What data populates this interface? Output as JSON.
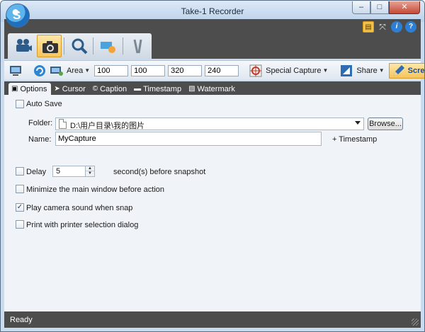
{
  "window": {
    "title": "Take-1 Recorder"
  },
  "window_buttons": {
    "minimize": "–",
    "maximize": "□",
    "close": "✕"
  },
  "ribbon_tools": {
    "info": "i",
    "help": "?"
  },
  "modes": [
    "video-camera",
    "photo-camera",
    "zoom",
    "highlight",
    "tools"
  ],
  "toolbar": {
    "area_label": "Area",
    "x": "100",
    "y": "100",
    "width": "320",
    "height": "240",
    "special_capture_label": "Special Capture",
    "share_label": "Share",
    "screen_label": "Scre"
  },
  "tabs": [
    {
      "label": "Options",
      "active": true
    },
    {
      "label": "Cursor",
      "active": false
    },
    {
      "label": "Caption",
      "active": false
    },
    {
      "label": "Timestamp",
      "active": false
    },
    {
      "label": "Watermark",
      "active": false
    }
  ],
  "options": {
    "auto_save_label": "Auto Save",
    "auto_save_checked": false,
    "folder_label": "Folder:",
    "folder_value": "D:\\用户目录\\我的图片",
    "browse_label": "Browse...",
    "name_label": "Name:",
    "name_value": "MyCapture",
    "timestamp_link": "+ Timestamp",
    "delay_label": "Delay",
    "delay_checked": false,
    "delay_value": "5",
    "delay_suffix": "second(s) before snapshot",
    "minimize_label": "Minimize the main window before action",
    "minimize_checked": false,
    "sound_label": "Play camera sound when snap",
    "sound_checked": true,
    "print_label": "Print with printer selection dialog",
    "print_checked": false
  },
  "status": {
    "text": "Ready"
  }
}
